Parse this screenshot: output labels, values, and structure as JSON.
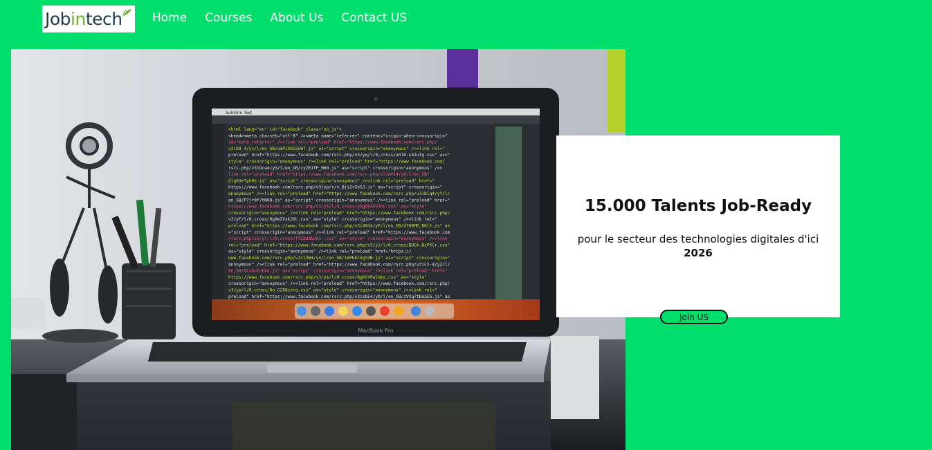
{
  "logo": {
    "part1": "Job",
    "part2": "in",
    "part3": "tech"
  },
  "nav": {
    "home": "Home",
    "courses": "Courses",
    "about": "About Us",
    "contact": "Contact US"
  },
  "hero": {
    "laptop_brand": "MacBook Pro",
    "editor_title": "Sublime Text",
    "code_lines": [
      "<html lang=\"en\" id=\"facebook\" class=\"no_js\">",
      "<head><meta charset=\"utf-8\" /><meta name=\"referrer\" content=\"origin-when-crossorigin\"",
      "id=\"meta_referrer\" /><link rel=\"preload\" href=\"https://www.facebook.com/rsrc.php/",
      "v3iD8_4/yc/l/en_GB/emPIXkOZnW7.js\" as=\"script\" crossorigin=\"anonymous\" /><link rel=\"",
      "preload\" href=\"https://www.facebook.com/rsrc.php/v3/yq/l/0,cross/ahlD-sGJuIg.css\" as=\"",
      "style\" crossorigin=\"anonymous\" /><link rel=\"preload\" href=\"https://www.facebook.com/",
      "rsrc.php/v3iDca4/yU/l/en_GB/cyZR1TP_H60.js\" as=\"script\" crossorigin=\"anonymous\" /><",
      "link rel=\"preload\" href=\"https://www.facebook.com/rsrc.php/v3imV14/yK/l/en_GB/",
      "Qlg6UeTyh0e.js\" as=\"script\" crossorigin=\"anonymous\" /><link rel=\"preload\" href=\"",
      "https://www.facebook.com/rsrc.php/v3/yp/r/v_Bjs2rSeSJ.js\" as=\"script\" crossorigin=\"",
      "anonymous\" /><link rel=\"preload\" href=\"https://www.facebook.com/rsrc.php/v3iDlq4/yY/l/",
      "en_GB/P7jr0f7tN0O.js\" as=\"script\" crossorigin=\"anonymous\" /><link rel=\"preload\" href=\"",
      "https://www.facebook.com/rsrc.php/v3/y5/l/0,cross/yGg6FAVS3nu.css\" as=\"style\"",
      "crossorigin=\"anonymous\" /><link rel=\"preload\" href=\"https://www.facebook.com/rsrc.php/",
      "v3/yF/l/0,cross/0g9mZVxkJ9L.css\" as=\"style\" crossorigin=\"anonymous\" /><link rel=\"",
      "preload\" href=\"https://www.facebook.com/rsrc.php/v3i4Xd4/yF/l/en_GB/d7H8ME_BKlt.js\" as",
      "=\"script\" crossorigin=\"anonymous\" /><link rel=\"preload\" href=\"https://www.facebook.com",
      "/rsrc.php/v3/yl/l/0,cross/TtI0ddNJAn-.css\" as=\"style\" crossorigin=\"anonymous\" /><link",
      "rel=\"preload\" href=\"https://www.facebook.com/rsrc.php/v3/yj/l/0,cross/BHGk-BzPXCr.css\"",
      "as=\"style\" crossorigin=\"anonymous\" /><link rel=\"preload\" href=\"https://",
      "www.facebook.com/rsrc.php/v3i1VW4/y4/l/en_GB/16PbECVgtdB.js\" as=\"script\" crossorigin=\"",
      "anonymous\" /><link rel=\"preload\" href=\"https://www.facebook.com/rsrc.php/v3iC2-4/yZ/l/",
      "en_GB/XLxmu2nbbu.js\" as=\"script\" crossorigin=\"anonymous\" /><link rel=\"preload\" href=\"",
      "https://www.facebook.com/rsrc.php/v3/ys/l/0,cross/BgKVY0wlmks.css\" as=\"style\"",
      "crossorigin=\"anonymous\" /><link rel=\"preload\" href=\"https://www.facebook.com/rsrc.php/",
      "v3/yp/l/0,cross/0o_G208zsrq.css\" as=\"style\" crossorigin=\"anonymous\" /><link rel=\"",
      "preload\" href=\"https://www.facebook.com/rsrc.php/v3isbE4/yD/l/en_GB/zVXq7tBaaE6.js\" as"
    ]
  },
  "card": {
    "title": "15.000 Talents Job-Ready",
    "subtitle": "pour le secteur des technologies digitales d'ici",
    "year": "2026"
  },
  "cta": {
    "label": "Join US"
  },
  "colors": {
    "page_bg": "#00de6b",
    "card_bg": "#ffffff",
    "nav_text": "#ffffff",
    "logo_accent": "#6cae2a"
  }
}
